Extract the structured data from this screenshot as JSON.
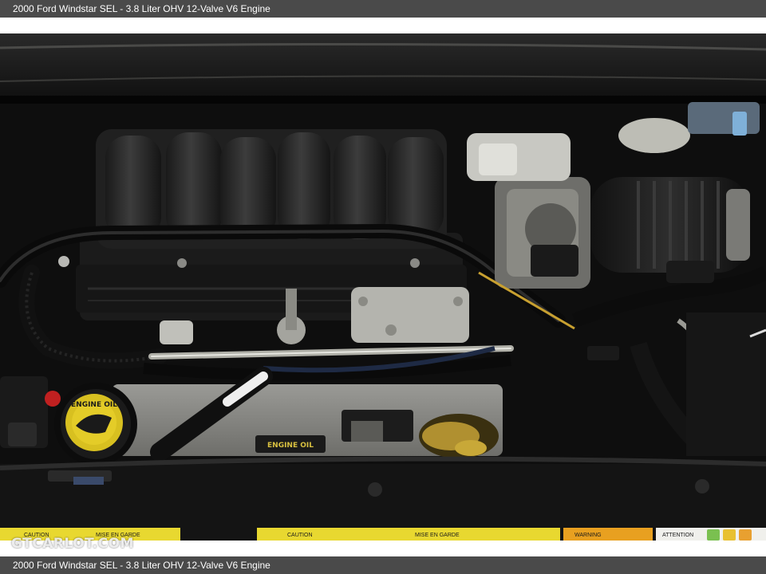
{
  "caption": {
    "top": "2000 Ford Windstar SEL - 3.8 Liter OHV 12-Valve V6 Engine",
    "bottom": "2000 Ford Windstar SEL - 3.8 Liter OHV 12-Valve V6 Engine"
  },
  "photo": {
    "oil_cap_label": "ENGINE OIL",
    "cover_label": "ENGINE OIL",
    "watermark_logo": "GTCARLOT.COM",
    "warning_labels": [
      "CAUTION",
      "MISE EN GARDE",
      "CAUTION",
      "MISE EN GARDE",
      "WARNING",
      "ATTENTION"
    ]
  }
}
